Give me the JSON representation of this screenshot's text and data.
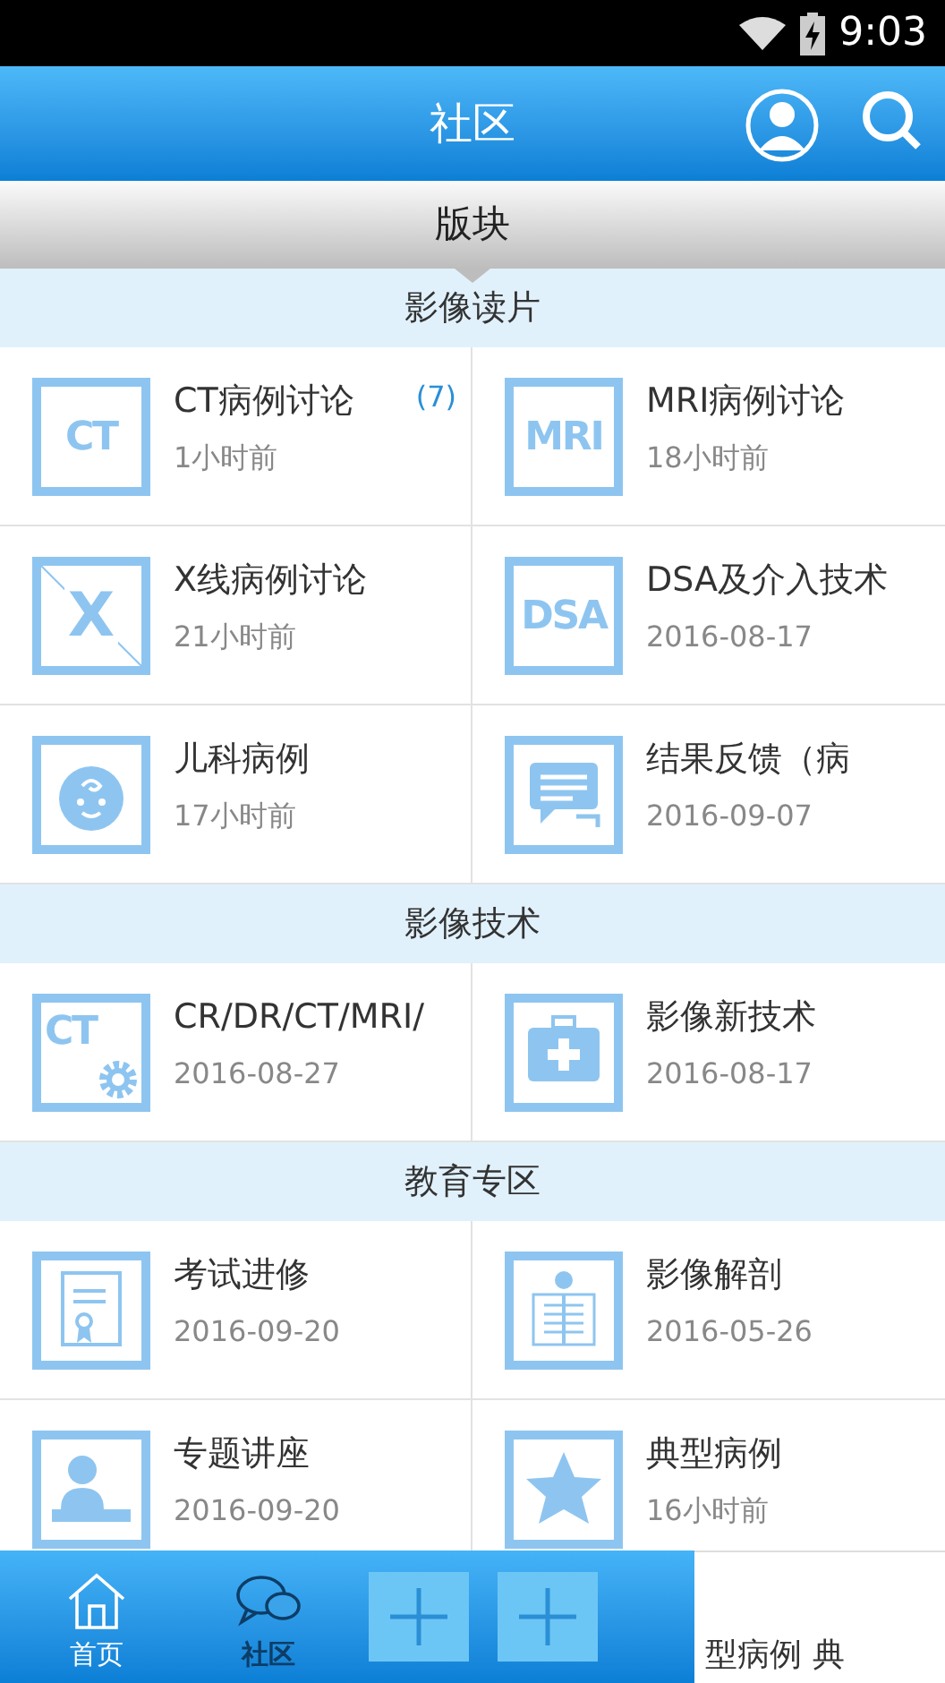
{
  "status_bar": {
    "time": "9:03"
  },
  "header": {
    "title": "社区"
  },
  "tab_bar": {
    "label": "版块"
  },
  "sections": [
    {
      "title": "影像读片",
      "items": [
        {
          "kind": "text",
          "icon_text": "CT",
          "name": "CT病例讨论",
          "count": "(7)",
          "time": "1小时前"
        },
        {
          "kind": "text",
          "icon_text": "MRI",
          "name": "MRI病例讨论",
          "time": "18小时前"
        },
        {
          "kind": "xray",
          "icon_text": "X",
          "name": "X线病例讨论",
          "time": "21小时前"
        },
        {
          "kind": "text",
          "icon_text": "DSA",
          "name": "DSA及介入技术",
          "time": "2016-08-17"
        },
        {
          "kind": "baby",
          "name": "儿科病例",
          "time": "17小时前"
        },
        {
          "kind": "chat",
          "name": "结果反馈（病",
          "time": "2016-09-07"
        }
      ]
    },
    {
      "title": "影像技术",
      "items": [
        {
          "kind": "gear",
          "icon_text": "CT",
          "name": "CR/DR/CT/MRI/",
          "time": "2016-08-27"
        },
        {
          "kind": "medkit",
          "name": "影像新技术",
          "time": "2016-08-17"
        }
      ]
    },
    {
      "title": "教育专区",
      "items": [
        {
          "kind": "certificate",
          "name": "考试进修",
          "time": "2016-09-20"
        },
        {
          "kind": "skeleton",
          "name": "影像解剖",
          "time": "2016-05-26"
        },
        {
          "kind": "lecturer",
          "name": "专题讲座",
          "time": "2016-09-20"
        },
        {
          "kind": "star",
          "name": "典型病例",
          "time": "16小时前"
        }
      ]
    }
  ],
  "bottom_nav": [
    {
      "kind": "home",
      "label": "首页",
      "selected": false
    },
    {
      "kind": "community",
      "label": "社区",
      "selected": true
    },
    {
      "kind": "plus"
    },
    {
      "kind": "plus"
    }
  ],
  "overlay_fragment": {
    "line_1": "型病例",
    "line_2": "典"
  }
}
